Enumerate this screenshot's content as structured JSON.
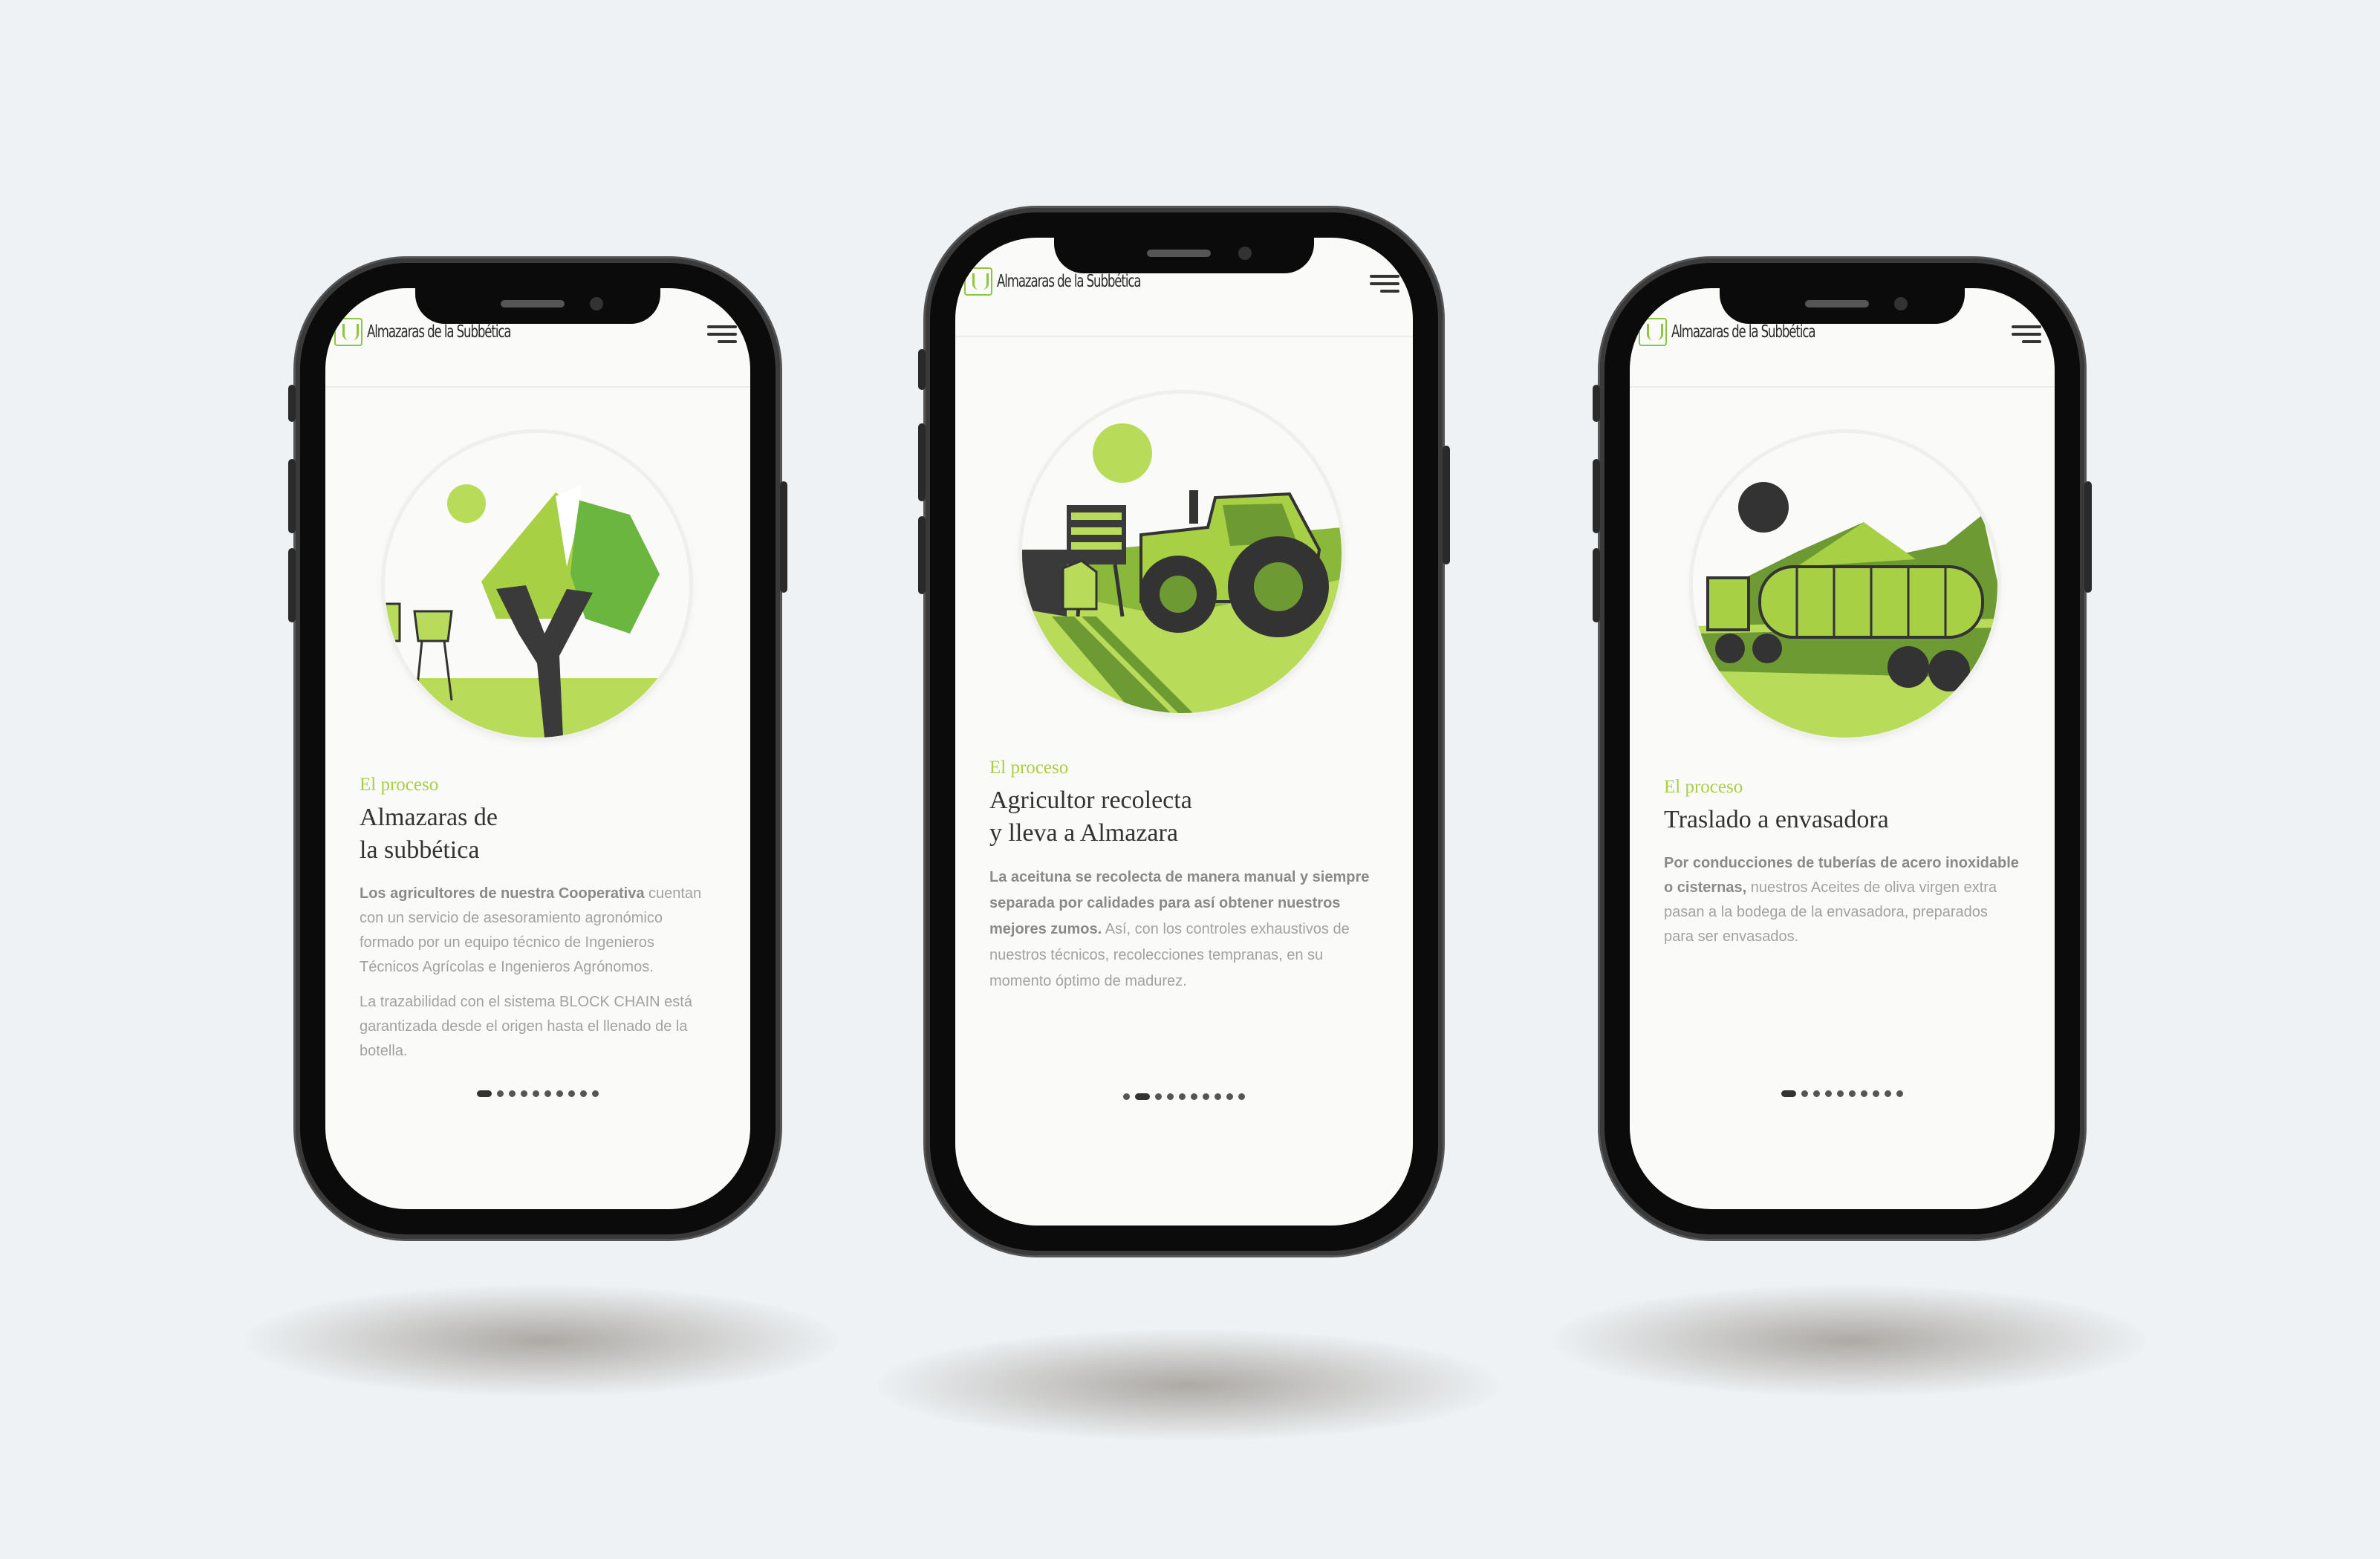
{
  "brand": {
    "logo_text": "Almazaras de la Subbética",
    "accent": "#a8cf45"
  },
  "phones": [
    {
      "kicker": "El proceso",
      "title_line1": "Almazaras de",
      "title_line2": "la subbética",
      "p1_bold": "Los agricultores de nuestra Cooperativa",
      "p1_rest": " cuentan con un servicio de asesoramiento agronómico formado por un equipo técnico de Ingenieros Técnicos Agrícolas e Ingenieros Agrónomos.",
      "p2": "La trazabilidad con el sistema BLOCK CHAIN está garantizada desde el origen hasta el llenado de la botella.",
      "active_slide": 1,
      "total_slides": 10
    },
    {
      "kicker": "El proceso",
      "title_line1": "Agricultor recolecta",
      "title_line2": "y lleva a Almazara",
      "p1_bold": "La aceituna se recolecta de manera manual y siempre separada por calidades para así obtener nuestros mejores zumos.",
      "p1_rest": " Así, con los controles exhaustivos de nuestros técnicos, recolecciones tempranas, en su momento óptimo de madurez.",
      "active_slide": 2,
      "total_slides": 10
    },
    {
      "kicker": "El proceso",
      "title_line1": "Traslado a envasadora",
      "p1_bold": "Por conducciones de tuberías de acero inoxidable o cisternas,",
      "p1_rest": " nuestros Aceites de oliva virgen extra pasan a la bodega de la envasadora, preparados para ser envasados.",
      "active_slide": 1,
      "total_slides": 10
    }
  ]
}
